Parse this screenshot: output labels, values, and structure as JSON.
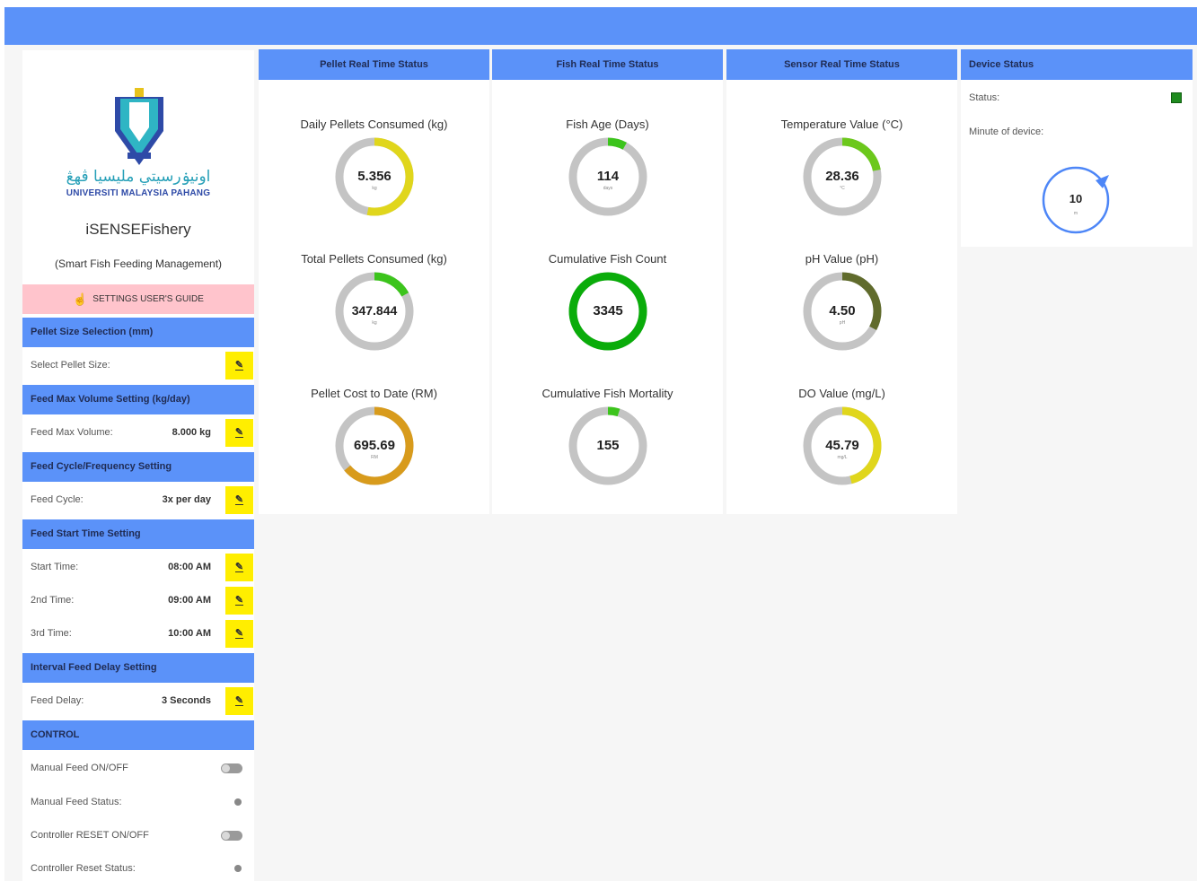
{
  "colors": {
    "header_blue": "#5b92f9",
    "edit_yellow": "#ffee00",
    "guide_pink": "#ffc4cc",
    "track_gray": "#c4c4c4",
    "status_green": "#1f8b1f"
  },
  "sidebar": {
    "logo_arabic": "اونيۏرسيتي مليسيا ڤهڠ",
    "logo_english": "UNIVERSITI MALAYSIA PAHANG",
    "app_name": "iSENSEFishery",
    "app_subtitle": "(Smart Fish Feeding Management)",
    "guide_button": "SETTINGS USER'S GUIDE",
    "edit_label": "✎",
    "sections": {
      "pellet_size": "Pellet Size Selection (mm)",
      "feed_max": "Feed Max Volume Setting (kg/day)",
      "feed_cycle": "Feed Cycle/Frequency Setting",
      "feed_start": "Feed Start Time Setting",
      "interval": "Interval Feed Delay Setting",
      "control": "CONTROL"
    },
    "rows": {
      "pellet_size": {
        "label": "Select Pellet Size:",
        "value": ""
      },
      "feed_max": {
        "label": "Feed Max Volume:",
        "value": "8.000 kg"
      },
      "feed_cycle": {
        "label": "Feed Cycle:",
        "value": "3x per day"
      },
      "start_time": {
        "label": "Start Time:",
        "value": "08:00 AM"
      },
      "second_time": {
        "label": "2nd Time:",
        "value": "09:00 AM"
      },
      "third_time": {
        "label": "3rd Time:",
        "value": "10:00 AM"
      },
      "feed_delay": {
        "label": "Feed Delay:",
        "value": "3 Seconds"
      }
    },
    "controls": {
      "manual_feed_toggle": "Manual Feed ON/OFF",
      "manual_feed_status": "Manual Feed Status:",
      "reset_toggle": "Controller RESET ON/OFF",
      "reset_status": "Controller Reset Status:"
    }
  },
  "panels": {
    "pellet": {
      "title": "Pellet Real Time Status",
      "gauges": [
        {
          "title": "Daily Pellets Consumed (kg)",
          "value": "5.356",
          "unit": "kg",
          "fraction": 0.53,
          "color": "#e0d61c"
        },
        {
          "title": "Total Pellets Consumed (kg)",
          "value": "347.844",
          "unit": "kg",
          "fraction": 0.17,
          "color": "#3cc41c"
        },
        {
          "title": "Pellet Cost to Date (RM)",
          "value": "695.69",
          "unit": "RM",
          "fraction": 0.64,
          "color": "#d89b1c"
        }
      ]
    },
    "fish": {
      "title": "Fish Real Time Status",
      "gauges": [
        {
          "title": "Fish Age (Days)",
          "value": "114",
          "unit": "days",
          "fraction": 0.08,
          "color": "#3cc41c"
        },
        {
          "title": "Cumulative Fish Count",
          "value": "3345",
          "unit": "",
          "fraction": 1.0,
          "color": "#0aac0a"
        },
        {
          "title": "Cumulative Fish Mortality",
          "value": "155",
          "unit": "",
          "fraction": 0.05,
          "color": "#3cc41c"
        }
      ]
    },
    "sensor": {
      "title": "Sensor Real Time Status",
      "gauges": [
        {
          "title": "Temperature Value (°C)",
          "value": "28.36",
          "unit": "°C",
          "fraction": 0.22,
          "color": "#6cc81c"
        },
        {
          "title": "pH Value (pH)",
          "value": "4.50",
          "unit": "pH",
          "fraction": 0.33,
          "color": "#606b2c"
        },
        {
          "title": "DO Value (mg/L)",
          "value": "45.79",
          "unit": "mg/L",
          "fraction": 0.46,
          "color": "#e0d61c"
        }
      ]
    }
  },
  "device": {
    "title": "Device Status",
    "status_label": "Status:",
    "minute_label": "Minute of device:",
    "minute_value": "10",
    "minute_unit": "m"
  }
}
